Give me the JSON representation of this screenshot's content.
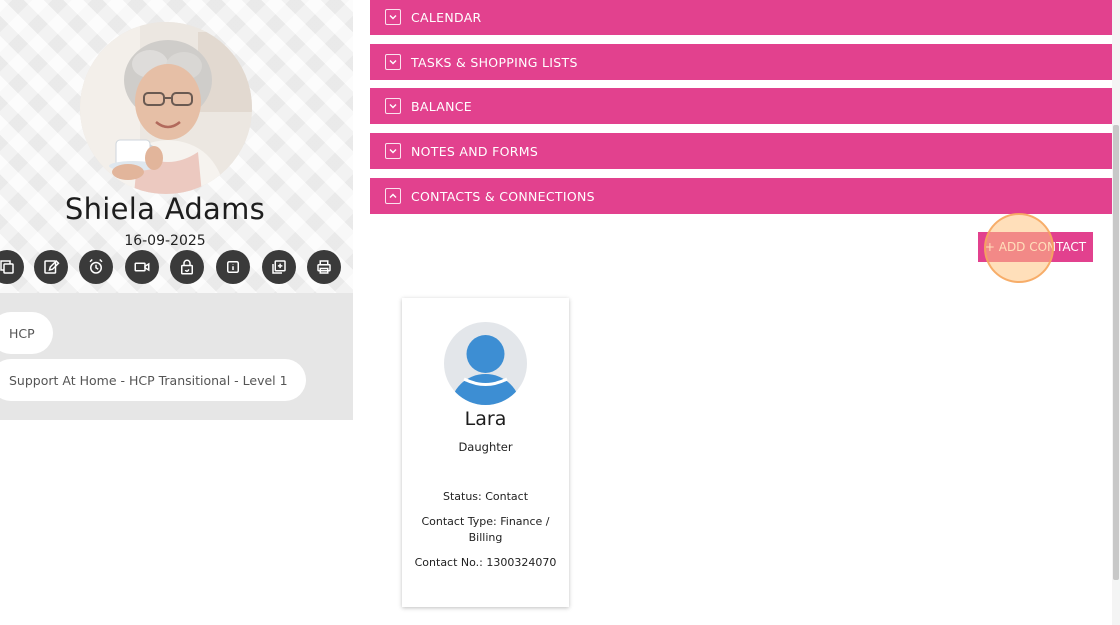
{
  "profile": {
    "name": "Shiela Adams",
    "date": "16-09-2025",
    "actions": [
      {
        "icon": "copy-icon"
      },
      {
        "icon": "edit-icon"
      },
      {
        "icon": "alarm-clock-icon"
      },
      {
        "icon": "video-camera-icon"
      },
      {
        "icon": "lock-reset-icon"
      },
      {
        "icon": "info-icon"
      },
      {
        "icon": "add-box-icon"
      },
      {
        "icon": "printer-icon"
      }
    ]
  },
  "tags": [
    "HCP",
    "Support At Home - HCP Transitional - Level 1"
  ],
  "accordion": [
    {
      "label": "CALENDAR",
      "expanded": false
    },
    {
      "label": "TASKS & SHOPPING LISTS",
      "expanded": false
    },
    {
      "label": "BALANCE",
      "expanded": false
    },
    {
      "label": "NOTES AND FORMS",
      "expanded": false
    },
    {
      "label": "CONTACTS & CONNECTIONS",
      "expanded": true
    }
  ],
  "contacts": {
    "add_label": "+ ADD CONTACT",
    "items": [
      {
        "name": "Lara",
        "relationship": "Daughter",
        "status": "Status: Contact",
        "type": "Contact Type: Finance / Billing",
        "number": "Contact No.: 1300324070"
      }
    ]
  },
  "colors": {
    "accent": "#e2418e",
    "action_button": "#3a3a3a",
    "avatar_blue": "#3d8ed3",
    "avatar_bg": "#e3e6ea"
  }
}
